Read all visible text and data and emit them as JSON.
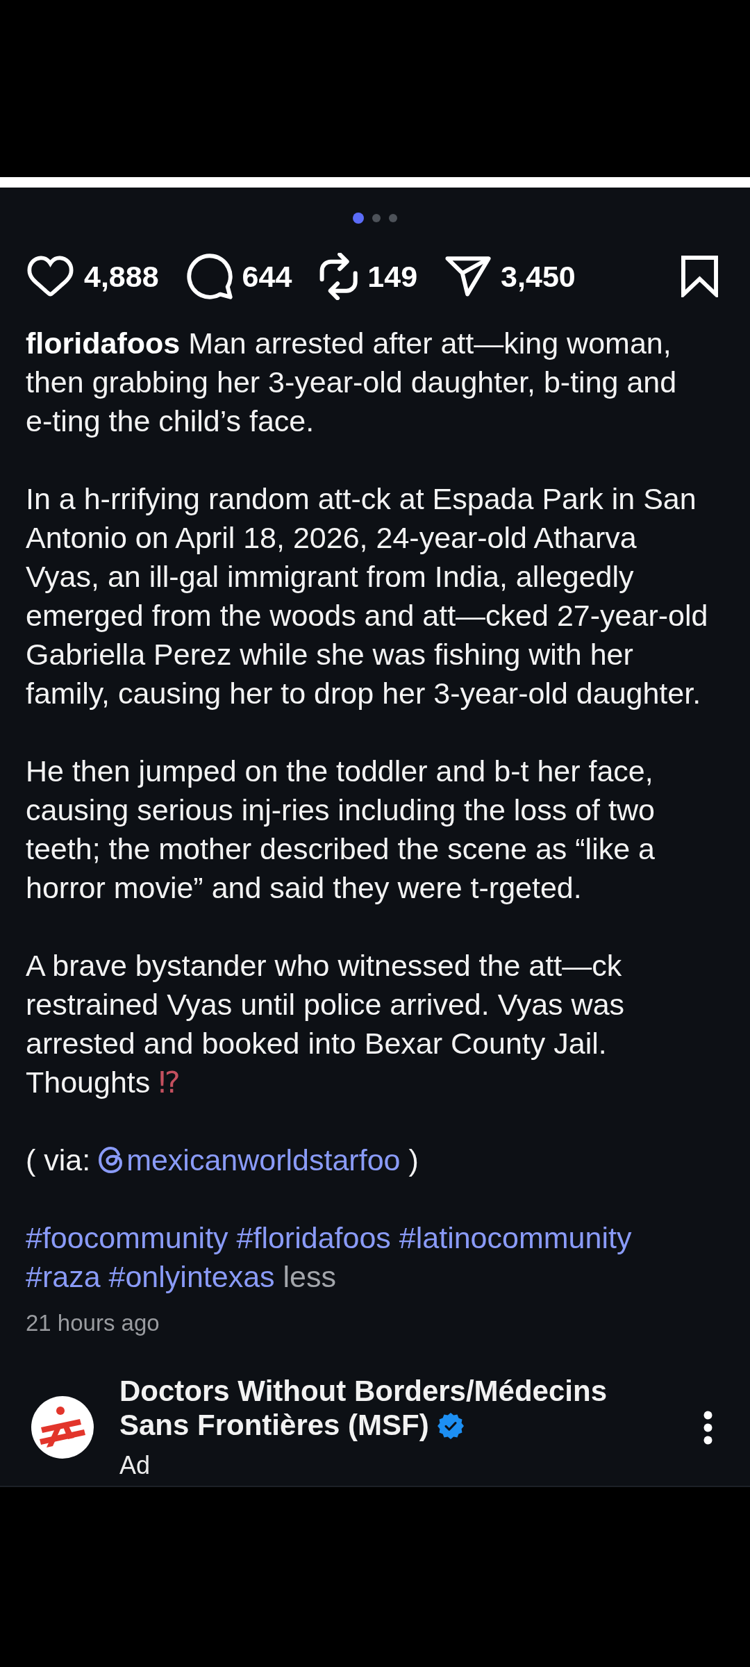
{
  "carousel_dots": [
    {
      "selected": true
    },
    {
      "selected": false
    },
    {
      "selected": false
    }
  ],
  "actions": [
    {
      "kind": "like",
      "count": "4,888"
    },
    {
      "kind": "comment",
      "count": "644"
    },
    {
      "kind": "repost",
      "count": "149"
    },
    {
      "kind": "share",
      "count": "3,450"
    }
  ],
  "bookmark": {
    "saved": false
  },
  "caption": {
    "username": "floridafoos",
    "paragraphs": [
      {
        "text": "Man arrested after att—king woman, then grabbing her 3-year-old daughter, b-ting and e-ting the child’s face."
      },
      {
        "text": "In a h-rrifying random att-ck at Espada Park in San Antonio on April 18, 2026, 24-year-old Atharva Vyas, an ill-gal immigrant from India, allegedly emerged from the woods and att—cked 27-year-old Gabriella Perez while she was fishing with her family, causing her to drop her 3-year-old daughter."
      },
      {
        "text": "He then jumped on the toddler and b-t her face, causing serious inj-ries including the loss of two teeth; the mother described the scene as “like a horror movie” and said they were t-rgeted."
      },
      {
        "text": "A brave bystander who witnessed the att—ck restrained Vyas until police arrived. Vyas was arrested and booked into Bexar County Jail. Thoughts",
        "emoji": "⁉"
      }
    ],
    "via": {
      "before": "( via:",
      "handle": "mexicanworldstarfoo",
      "after": ")"
    },
    "hashtags": [
      "#foocommunity",
      "#floridafoos",
      "#latinocommunity",
      "#raza",
      "#onlyintexas"
    ],
    "less_label": "less",
    "time": "21 hours ago"
  },
  "sponsor": {
    "name": "Doctors Without Borders/Médecins Sans Frontières (MSF)",
    "verified": true,
    "label": "Ad"
  }
}
